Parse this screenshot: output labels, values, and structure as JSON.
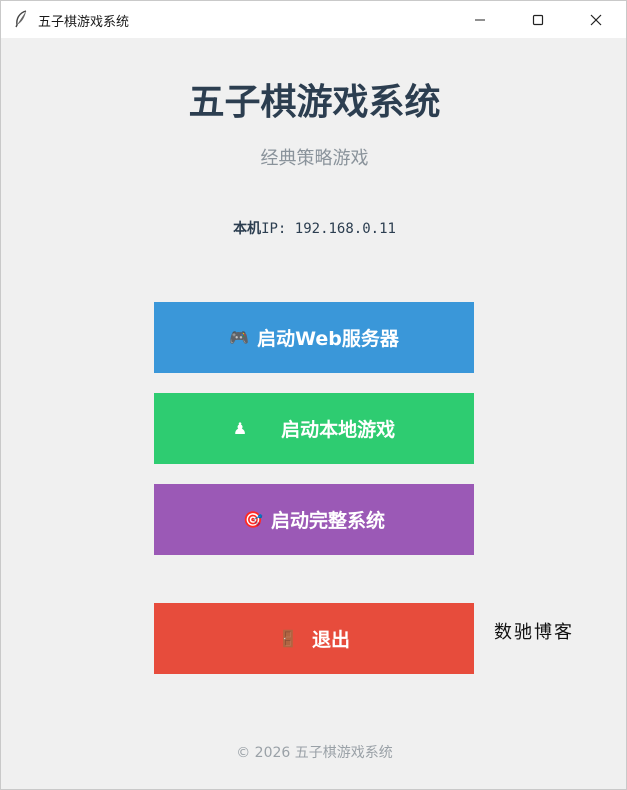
{
  "window": {
    "title": "五子棋游戏系统",
    "icon": "feather-icon"
  },
  "header": {
    "title": "五子棋游戏系统",
    "subtitle": "经典策略游戏"
  },
  "network": {
    "ip_label": "本机",
    "ip_value": "IP: 192.168.0.11"
  },
  "buttons": [
    {
      "label": "启动Web服务器",
      "icon": "gamepad-icon",
      "icon_char": "🎮",
      "color": "#3a97d9"
    },
    {
      "label": "启动本地游戏",
      "icon": "chess-pawn-icon",
      "icon_char": "♟",
      "color": "#2ecc71"
    },
    {
      "label": "启动完整系统",
      "icon": "target-icon",
      "icon_char": "🎯",
      "color": "#9b59b6"
    },
    {
      "label": "退出",
      "icon": "exit-door-icon",
      "icon_char": "🚪",
      "color": "#e74c3c"
    }
  ],
  "watermark": "数驰博客",
  "footer": "© 2026 五子棋游戏系统"
}
